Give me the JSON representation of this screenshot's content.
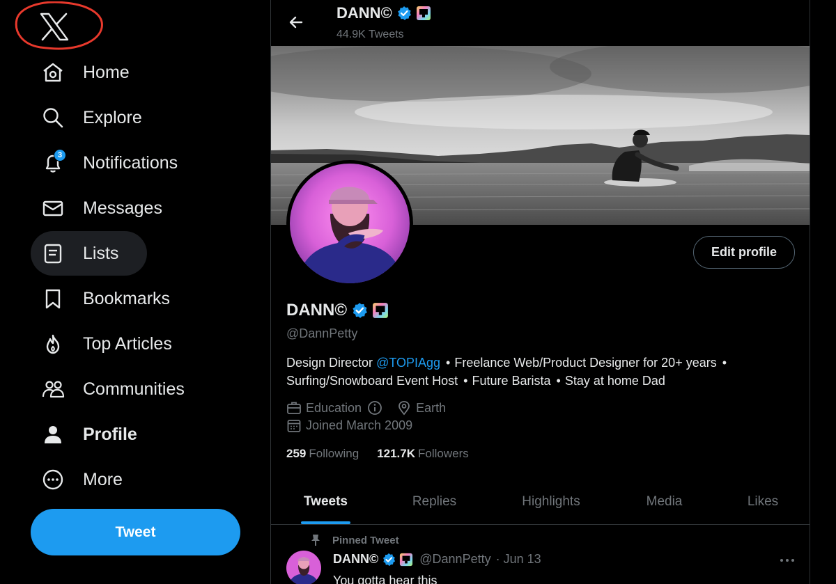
{
  "app": {
    "name": "X"
  },
  "sidebar": {
    "items": [
      {
        "label": "Home",
        "icon": "home-icon"
      },
      {
        "label": "Explore",
        "icon": "search-icon"
      },
      {
        "label": "Notifications",
        "icon": "bell-icon",
        "badge": "3"
      },
      {
        "label": "Messages",
        "icon": "envelope-icon"
      },
      {
        "label": "Lists",
        "icon": "list-icon",
        "active": true
      },
      {
        "label": "Bookmarks",
        "icon": "bookmark-icon"
      },
      {
        "label": "Top Articles",
        "icon": "flame-icon"
      },
      {
        "label": "Communities",
        "icon": "people-icon"
      },
      {
        "label": "Profile",
        "icon": "person-icon"
      },
      {
        "label": "More",
        "icon": "more-circle-icon"
      }
    ],
    "tweet_button": "Tweet"
  },
  "header": {
    "name": "DANN©",
    "tweet_count": "44.9K Tweets"
  },
  "profile": {
    "name": "DANN©",
    "handle": "@DannPetty",
    "edit_button": "Edit profile",
    "bio": {
      "line1_prefix": "Design Director",
      "mention": "@TOPIAgg",
      "sep": "•",
      "line1_rest": "Freelance Web/Product Designer for 20+  years",
      "line2_a": "Surfing/Snowboard Event Host",
      "line2_b": "Future Barista",
      "line2_c": "Stay at home Dad"
    },
    "category": "Education",
    "location": "Earth",
    "joined": "Joined March 2009",
    "following_count": "259",
    "following_label": "Following",
    "followers_count": "121.7K",
    "followers_label": "Followers"
  },
  "tabs": [
    {
      "label": "Tweets",
      "active": true
    },
    {
      "label": "Replies"
    },
    {
      "label": "Highlights"
    },
    {
      "label": "Media"
    },
    {
      "label": "Likes"
    }
  ],
  "pinned_tweet": {
    "label": "Pinned Tweet",
    "author": "DANN©",
    "handle": "@DannPetty",
    "date": "· Jun 13",
    "text": "You gotta hear this"
  },
  "colors": {
    "accent": "#1d9bf0",
    "background": "#000000",
    "text_primary": "#e7e9ea",
    "text_secondary": "#71767b",
    "annotation_circle": "#e8392c"
  }
}
